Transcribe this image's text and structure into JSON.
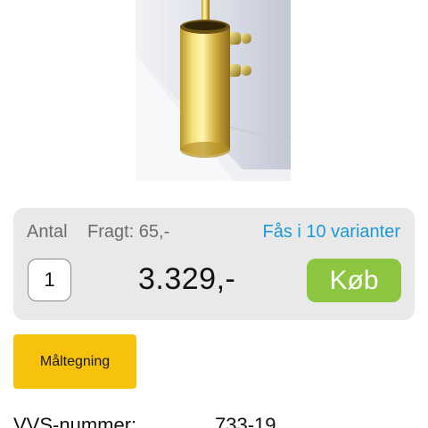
{
  "product": {
    "image_alt": "Brass toilet brush holder"
  },
  "purchase": {
    "quantity_label": "Antal",
    "shipping_label": "Fragt: 65,-",
    "variants_link": "Fås i 10 varianter",
    "quantity_value": "1",
    "price": "3.329,-",
    "buy_label": "Køb",
    "buy_color": "#8cc63f",
    "link_color": "#1a9ad6"
  },
  "actions": {
    "drawing_label": "Måltegning",
    "drawing_color": "#f7c20b"
  },
  "specs": {
    "vvs_label": "VVS-nummer:",
    "vvs_value": "733-19"
  }
}
